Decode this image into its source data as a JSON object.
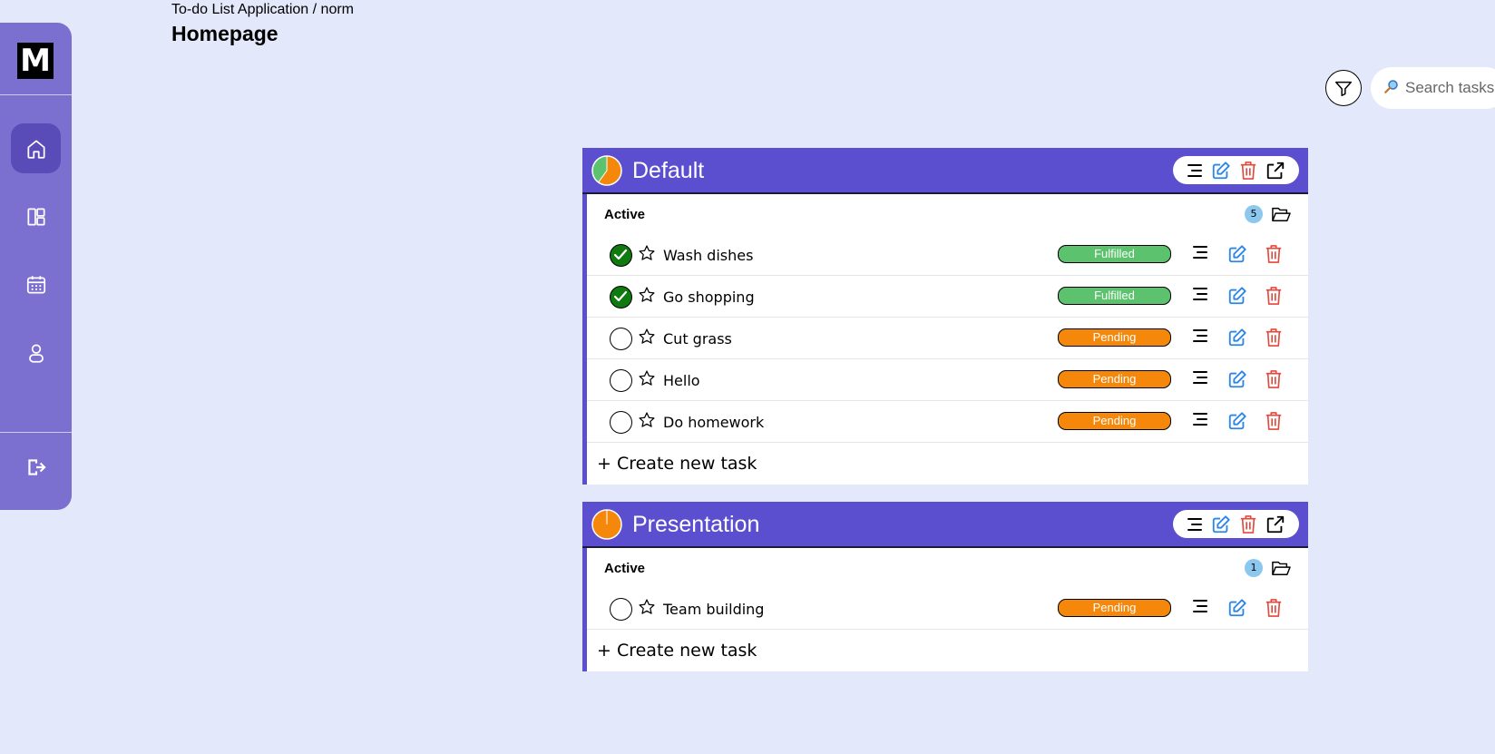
{
  "app": {
    "breadcrumb": "To-do List Application / norm",
    "page_title": "Homepage",
    "logo_text": "M"
  },
  "sidebar": {
    "items": [
      {
        "name": "home",
        "icon": "home-icon",
        "active": true
      },
      {
        "name": "dashboard",
        "icon": "dashboard-icon",
        "active": false
      },
      {
        "name": "calendar",
        "icon": "calendar-icon",
        "active": false
      },
      {
        "name": "profile",
        "icon": "user-icon",
        "active": false
      }
    ],
    "logout_icon": "logout-icon"
  },
  "toolbar": {
    "filter_icon": "filter-icon",
    "search_placeholder": "Search tasks",
    "search_icon": "search-icon"
  },
  "colors": {
    "accent": "#5b4fd0",
    "sidebar": "#7b6fd0",
    "fulfilled": "#5cc26e",
    "pending": "#f5880b",
    "edit": "#2b86e8",
    "delete": "#e5473a",
    "background": "#e3e8fa"
  },
  "lists": [
    {
      "title": "Default",
      "progress_fulfilled": 0.4,
      "section_label": "Active",
      "count": "5",
      "create_label": "+ Create new task",
      "tasks": [
        {
          "name": "Wash dishes",
          "status": "Fulfilled",
          "done": true
        },
        {
          "name": "Go shopping",
          "status": "Fulfilled",
          "done": true
        },
        {
          "name": "Cut grass",
          "status": "Pending",
          "done": false
        },
        {
          "name": "Hello",
          "status": "Pending",
          "done": false
        },
        {
          "name": "Do homework",
          "status": "Pending",
          "done": false
        }
      ]
    },
    {
      "title": "Presentation",
      "progress_fulfilled": 0,
      "section_label": "Active",
      "count": "1",
      "create_label": "+ Create new task",
      "tasks": [
        {
          "name": "Team building",
          "status": "Pending",
          "done": false
        }
      ]
    }
  ]
}
